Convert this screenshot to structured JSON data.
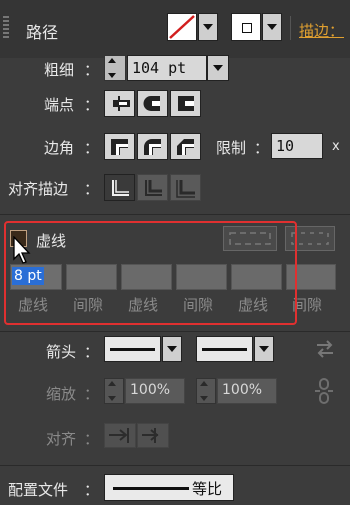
{
  "header": {
    "panel_title": "路径",
    "stroke_label": "描边："
  },
  "stroke": {
    "weight_label": "粗细",
    "weight_value": "104 pt",
    "cap_label": "端点",
    "corner_label": "边角",
    "limit_label": "限制",
    "limit_value": "10",
    "limit_suffix": "x",
    "align_label": "对齐描边",
    "colon": "："
  },
  "dashed": {
    "checkbox_label": "虚线",
    "checked": false,
    "dash1_value": "8 pt",
    "cells": [
      {
        "label": "虚线"
      },
      {
        "label": "间隙"
      },
      {
        "label": "虚线"
      },
      {
        "label": "间隙"
      },
      {
        "label": "虚线"
      },
      {
        "label": "间隙"
      }
    ],
    "highlight_color": "#e03030"
  },
  "arrows": {
    "arrow_label": "箭头",
    "scale_label": "缩放",
    "scale1_value": "100%",
    "scale2_value": "100%",
    "align_label": "对齐"
  },
  "profile": {
    "label": "配置文件",
    "value": "等比"
  },
  "colors": {
    "panel_bg": "#3c3c3c",
    "accent_orange": "#e0a030",
    "selection_blue": "#2a6ed6"
  }
}
